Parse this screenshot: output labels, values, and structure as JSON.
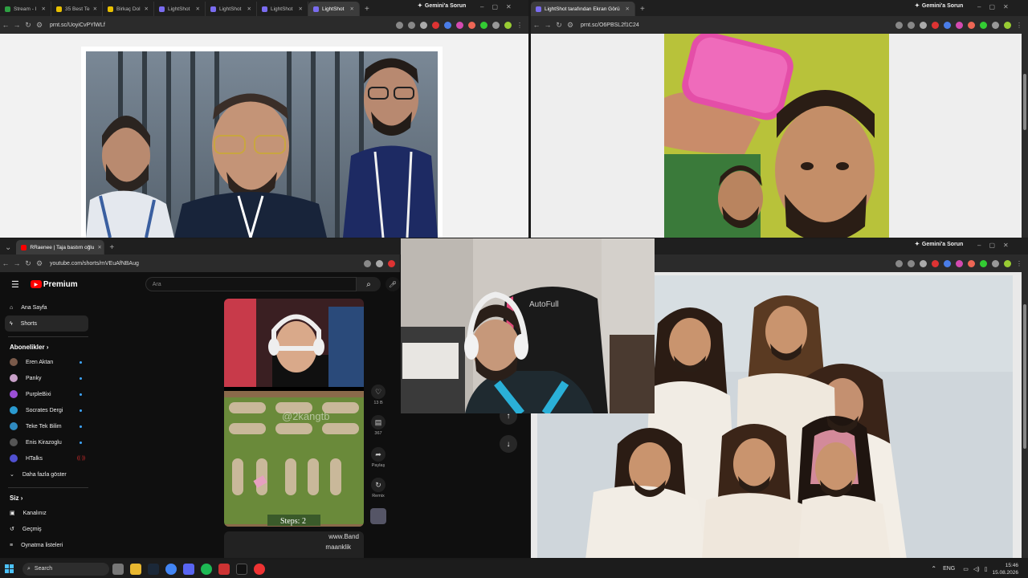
{
  "top_left_window": {
    "tabs": [
      "Stream - I",
      "35 Best Te",
      "Birkaç Dol",
      "LightShot",
      "LightShot",
      "LightShot",
      "LightShot"
    ],
    "gemini": "Gemini'a Sorun",
    "url": "prnt.sc/UoyiCvPYlWLf"
  },
  "top_right_window": {
    "tab": "LightShot tarafından Ekran Görü",
    "gemini": "Gemini'a Sorun",
    "url": "prnt.sc/O6PBSL2f1C24"
  },
  "bottom_left_window": {
    "tab": "RRaenee | Taja bastım oğlu",
    "url": "youtube.com/shorts/mVEuAfNBAug",
    "youtube": {
      "logo": "Premium",
      "search_placeholder": "Ara",
      "nav": [
        "Ana Sayfa",
        "Shorts"
      ],
      "subscriptions_title": "Abonelikler",
      "channels": [
        {
          "name": "Eren Aktan",
          "color": "#7a5a4a"
        },
        {
          "name": "Panky",
          "color": "#c8a0c8"
        },
        {
          "name": "PurpleBixi",
          "color": "#9b4fd6"
        },
        {
          "name": "Socrates Dergi",
          "color": "#2a9ad0"
        },
        {
          "name": "Teke Tek Bilim",
          "color": "#2f8ac0"
        },
        {
          "name": "Enis Kirazoglu",
          "color": "#555555"
        },
        {
          "name": "HTalks",
          "color": "#5050d0"
        }
      ],
      "live_label": "((·))",
      "show_more": "Daha fazla göster",
      "you_title": "Siz",
      "you_items": [
        "Kanalınız",
        "Geçmiş",
        "Oynatma listeleri"
      ],
      "actions": [
        {
          "icon": "♡",
          "label": "13 B"
        },
        {
          "icon": "▤",
          "label": "367"
        },
        {
          "icon": "➦",
          "label": "Paylaş"
        },
        {
          "icon": "↻",
          "label": "Remix"
        }
      ],
      "game_watermark": "@2kangtb",
      "game_steps": "Steps: 2",
      "next_text_1": "www.Band",
      "next_text_2": "maanklik"
    }
  },
  "bottom_right_window": {
    "gemini": "Gemini'a Sorun"
  },
  "webcam": {
    "chair_text": "AutoFull"
  },
  "taskbar": {
    "search": "Search",
    "lang": "ENG",
    "time": "15:46",
    "date": "15.08.2026"
  }
}
